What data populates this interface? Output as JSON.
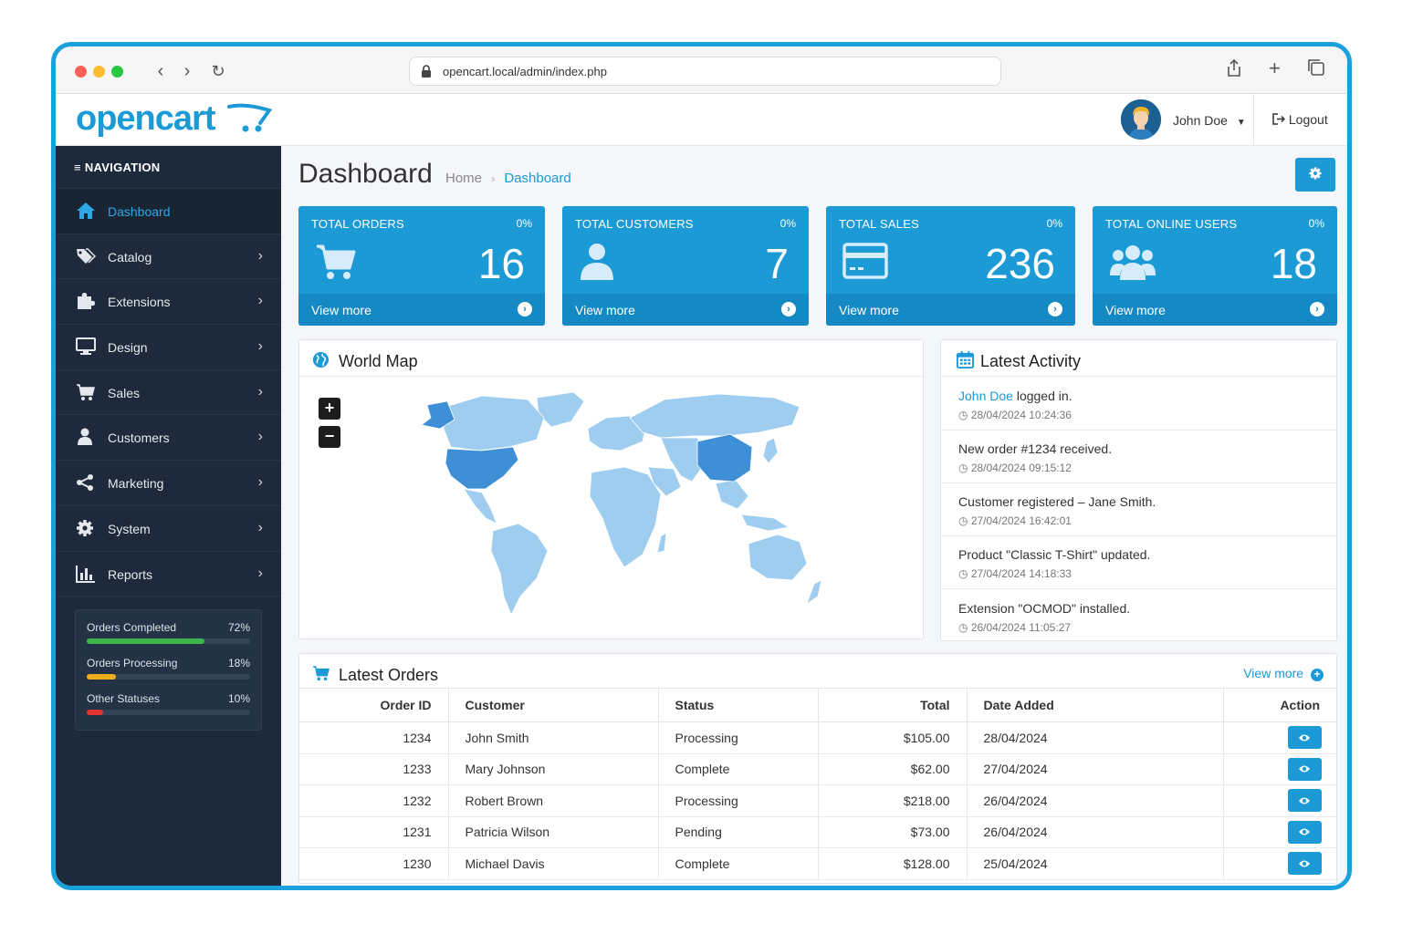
{
  "browser": {
    "url": "opencart.local/admin/index.php"
  },
  "header": {
    "logo": "opencart",
    "user_name": "John Doe",
    "logout_label": "Logout"
  },
  "sidebar": {
    "heading": "NAVIGATION",
    "items": [
      {
        "label": "Dashboard",
        "icon": "home-icon",
        "active": true
      },
      {
        "label": "Catalog",
        "icon": "tags-icon"
      },
      {
        "label": "Extensions",
        "icon": "puzzle-icon"
      },
      {
        "label": "Design",
        "icon": "monitor-icon"
      },
      {
        "label": "Sales",
        "icon": "cart-icon"
      },
      {
        "label": "Customers",
        "icon": "user-icon"
      },
      {
        "label": "Marketing",
        "icon": "share-icon"
      },
      {
        "label": "System",
        "icon": "gear-icon"
      },
      {
        "label": "Reports",
        "icon": "bar-chart-icon"
      }
    ],
    "stats": [
      {
        "label": "Orders Completed",
        "value": "72%",
        "percent": 72,
        "color": "#3cb54a"
      },
      {
        "label": "Orders Processing",
        "value": "18%",
        "percent": 18,
        "color": "#f0ad1e"
      },
      {
        "label": "Other Statuses",
        "value": "10%",
        "percent": 10,
        "color": "#e5342f"
      }
    ]
  },
  "page": {
    "title": "Dashboard",
    "breadcrumb_home": "Home",
    "breadcrumb_sep": "›",
    "breadcrumb_current": "Dashboard"
  },
  "tiles": [
    {
      "title": "TOTAL ORDERS",
      "percent": "0%",
      "value": "16",
      "footer": "View more",
      "icon": "cart-icon"
    },
    {
      "title": "TOTAL CUSTOMERS",
      "percent": "0%",
      "value": "7",
      "footer": "View more",
      "icon": "user-icon"
    },
    {
      "title": "TOTAL SALES",
      "percent": "0%",
      "value": "236",
      "footer": "View more",
      "icon": "credit-card-icon"
    },
    {
      "title": "TOTAL ONLINE USERS",
      "percent": "0%",
      "value": "18",
      "footer": "View more",
      "icon": "users-icon"
    }
  ],
  "world_map": {
    "title": "World Map",
    "zoom_in": "+",
    "zoom_out": "−",
    "highlight_color": "#3f8fd6",
    "base_color": "#9fcdf0"
  },
  "activity": {
    "title": "Latest Activity",
    "items": [
      {
        "link": "John Doe",
        "text": " logged in.",
        "date": "28/04/2024 10:24:36"
      },
      {
        "link": "",
        "text": "New order #1234 received.",
        "date": "28/04/2024 09:15:12"
      },
      {
        "link": "",
        "text": "Customer registered – Jane Smith.",
        "date": "27/04/2024 16:42:01"
      },
      {
        "link": "",
        "text": "Product \"Classic T-Shirt\" updated.",
        "date": "27/04/2024 14:18:33"
      },
      {
        "link": "",
        "text": "Extension \"OCMOD\" installed.",
        "date": "26/04/2024 11:05:27"
      }
    ]
  },
  "orders": {
    "title": "Latest Orders",
    "view_more": "View more",
    "columns": [
      "Order ID",
      "Customer",
      "Status",
      "Total",
      "Date Added",
      "Action"
    ],
    "rows": [
      {
        "id": "1234",
        "customer": "John Smith",
        "status": "Processing",
        "total": "$105.00",
        "date": "28/04/2024"
      },
      {
        "id": "1233",
        "customer": "Mary Johnson",
        "status": "Complete",
        "total": "$62.00",
        "date": "27/04/2024"
      },
      {
        "id": "1232",
        "customer": "Robert Brown",
        "status": "Processing",
        "total": "$218.00",
        "date": "26/04/2024"
      },
      {
        "id": "1231",
        "customer": "Patricia Wilson",
        "status": "Pending",
        "total": "$73.00",
        "date": "26/04/2024"
      },
      {
        "id": "1230",
        "customer": "Michael Davis",
        "status": "Complete",
        "total": "$128.00",
        "date": "25/04/2024"
      }
    ]
  },
  "colors": {
    "accent": "#1b9ad6",
    "sidebar": "#1e2a3b",
    "frame": "#1aa1dc"
  }
}
